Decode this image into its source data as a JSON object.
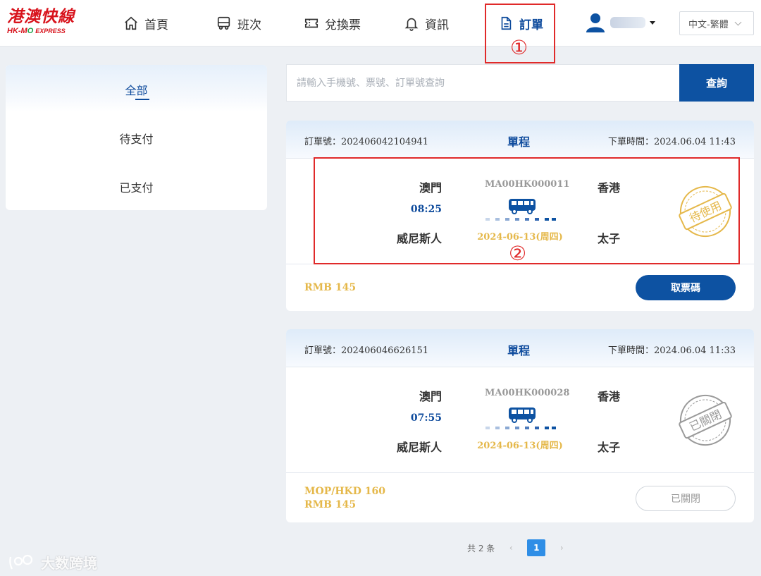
{
  "brand": {
    "name_zh": "港澳快線",
    "name_en_a": "HK-M",
    "name_en_b": "O",
    "name_en_c": "EXPRESS"
  },
  "nav": [
    {
      "label": "首頁",
      "icon": "home-icon"
    },
    {
      "label": "班次",
      "icon": "bus-icon"
    },
    {
      "label": "兌換票",
      "icon": "ticket-icon"
    },
    {
      "label": "資訊",
      "icon": "bell-icon"
    },
    {
      "label": "訂單",
      "icon": "document-icon",
      "active": true
    }
  ],
  "language": {
    "selected": "中文-繁體"
  },
  "annotations": {
    "marker1": "①",
    "marker2": "②"
  },
  "sidebar": {
    "items": [
      {
        "label": "全部",
        "active": true
      },
      {
        "label": "待支付"
      },
      {
        "label": "已支付"
      }
    ]
  },
  "search": {
    "placeholder": "請輸入手機號、票號、訂單號查詢",
    "value": "",
    "button_label": "查詢"
  },
  "orders": [
    {
      "order_label": "訂單號：",
      "order_no": "202406042104941",
      "trip_type": "單程",
      "time_label": "下單時間：",
      "order_time": "2024.06.04 11:43",
      "from_city": "澳門",
      "from_station": "威尼斯人",
      "departure": "08:25",
      "route_code": "MA00HK000011",
      "date": "2024-06-13(周四)",
      "to_city": "香港",
      "to_station": "太子",
      "stamp": "待使用",
      "stamp_color": "#e5b84a",
      "prices": [
        "RMB 145"
      ],
      "action_label": "取票碼"
    },
    {
      "order_label": "訂單號：",
      "order_no": "202406046626151",
      "trip_type": "單程",
      "time_label": "下單時間：",
      "order_time": "2024.06.04 11:33",
      "from_city": "澳門",
      "from_station": "威尼斯人",
      "departure": "07:55",
      "route_code": "MA00HK000028",
      "date": "2024-06-13(周四)",
      "to_city": "香港",
      "to_station": "太子",
      "stamp": "已關閉",
      "stamp_color": "#9a9a9a",
      "prices": [
        "MOP/HKD 160",
        "RMB 145"
      ],
      "action_label": "已關閉"
    }
  ],
  "pagination": {
    "total_text": "共 2 条",
    "current": "1",
    "prev": "‹",
    "next": "›"
  },
  "watermark": "大数跨境",
  "colors": {
    "primary": "#0d52a2",
    "accent_gold": "#e5b84a",
    "annotation_red": "#e02a2a"
  }
}
